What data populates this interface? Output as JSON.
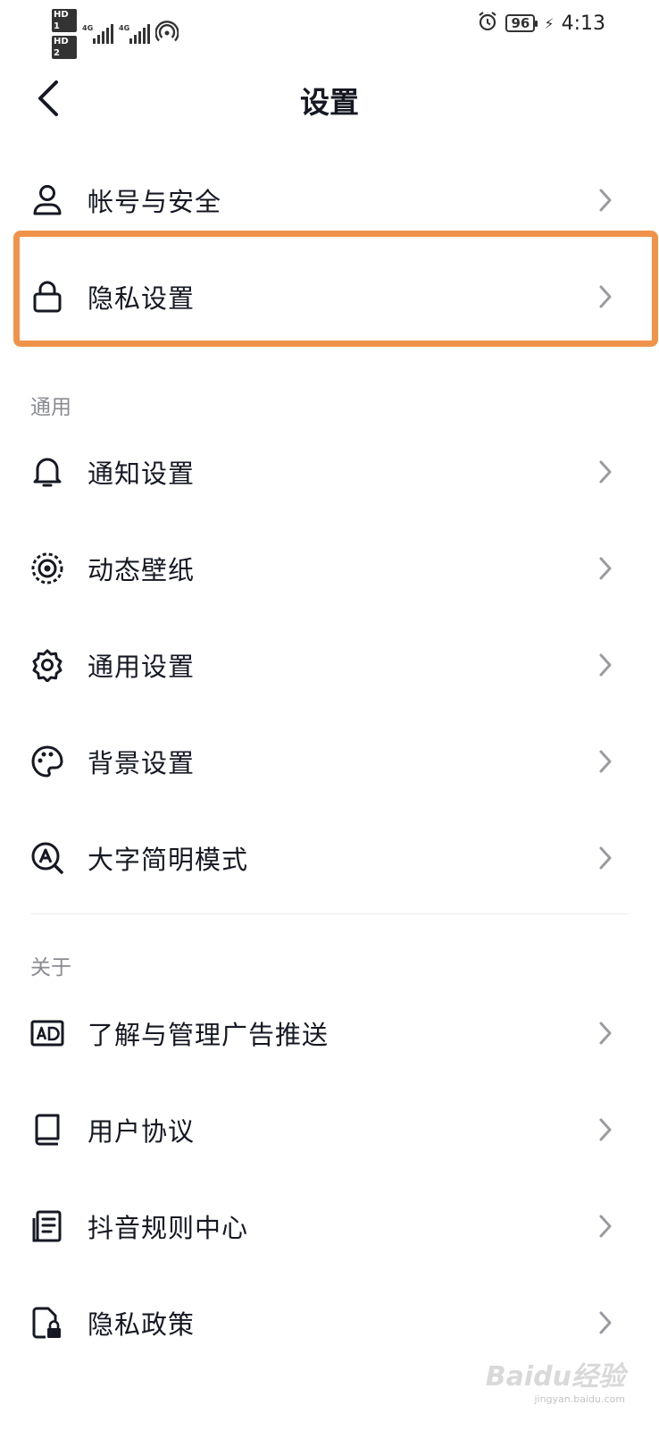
{
  "status_bar": {
    "hd1": "HD 1",
    "hd2": "HD 2",
    "sim1_tag": "4G",
    "sim2_tag": "4G",
    "battery": "96",
    "time": "4:13"
  },
  "header": {
    "title": "设置"
  },
  "account_items": [
    {
      "label": "帐号与安全",
      "icon": "person-icon"
    },
    {
      "label": "隐私设置",
      "icon": "lock-icon"
    }
  ],
  "general": {
    "section_title": "通用",
    "items": [
      {
        "label": "通知设置",
        "icon": "bell-icon"
      },
      {
        "label": "动态壁纸",
        "icon": "wallpaper-icon"
      },
      {
        "label": "通用设置",
        "icon": "gear-icon"
      },
      {
        "label": "背景设置",
        "icon": "palette-icon"
      },
      {
        "label": "大字简明模式",
        "icon": "large-text-icon"
      }
    ]
  },
  "about": {
    "section_title": "关于",
    "items": [
      {
        "label": "了解与管理广告推送",
        "icon": "ad-icon"
      },
      {
        "label": "用户协议",
        "icon": "book-icon"
      },
      {
        "label": "抖音规则中心",
        "icon": "document-icon"
      },
      {
        "label": "隐私政策",
        "icon": "privacy-policy-icon"
      }
    ]
  },
  "colors": {
    "highlight": "#f0934a",
    "text": "#161823",
    "secondary": "#8a8b91"
  },
  "watermark": {
    "brand": "Baidu经验",
    "url": "jingyan.baidu.com"
  }
}
